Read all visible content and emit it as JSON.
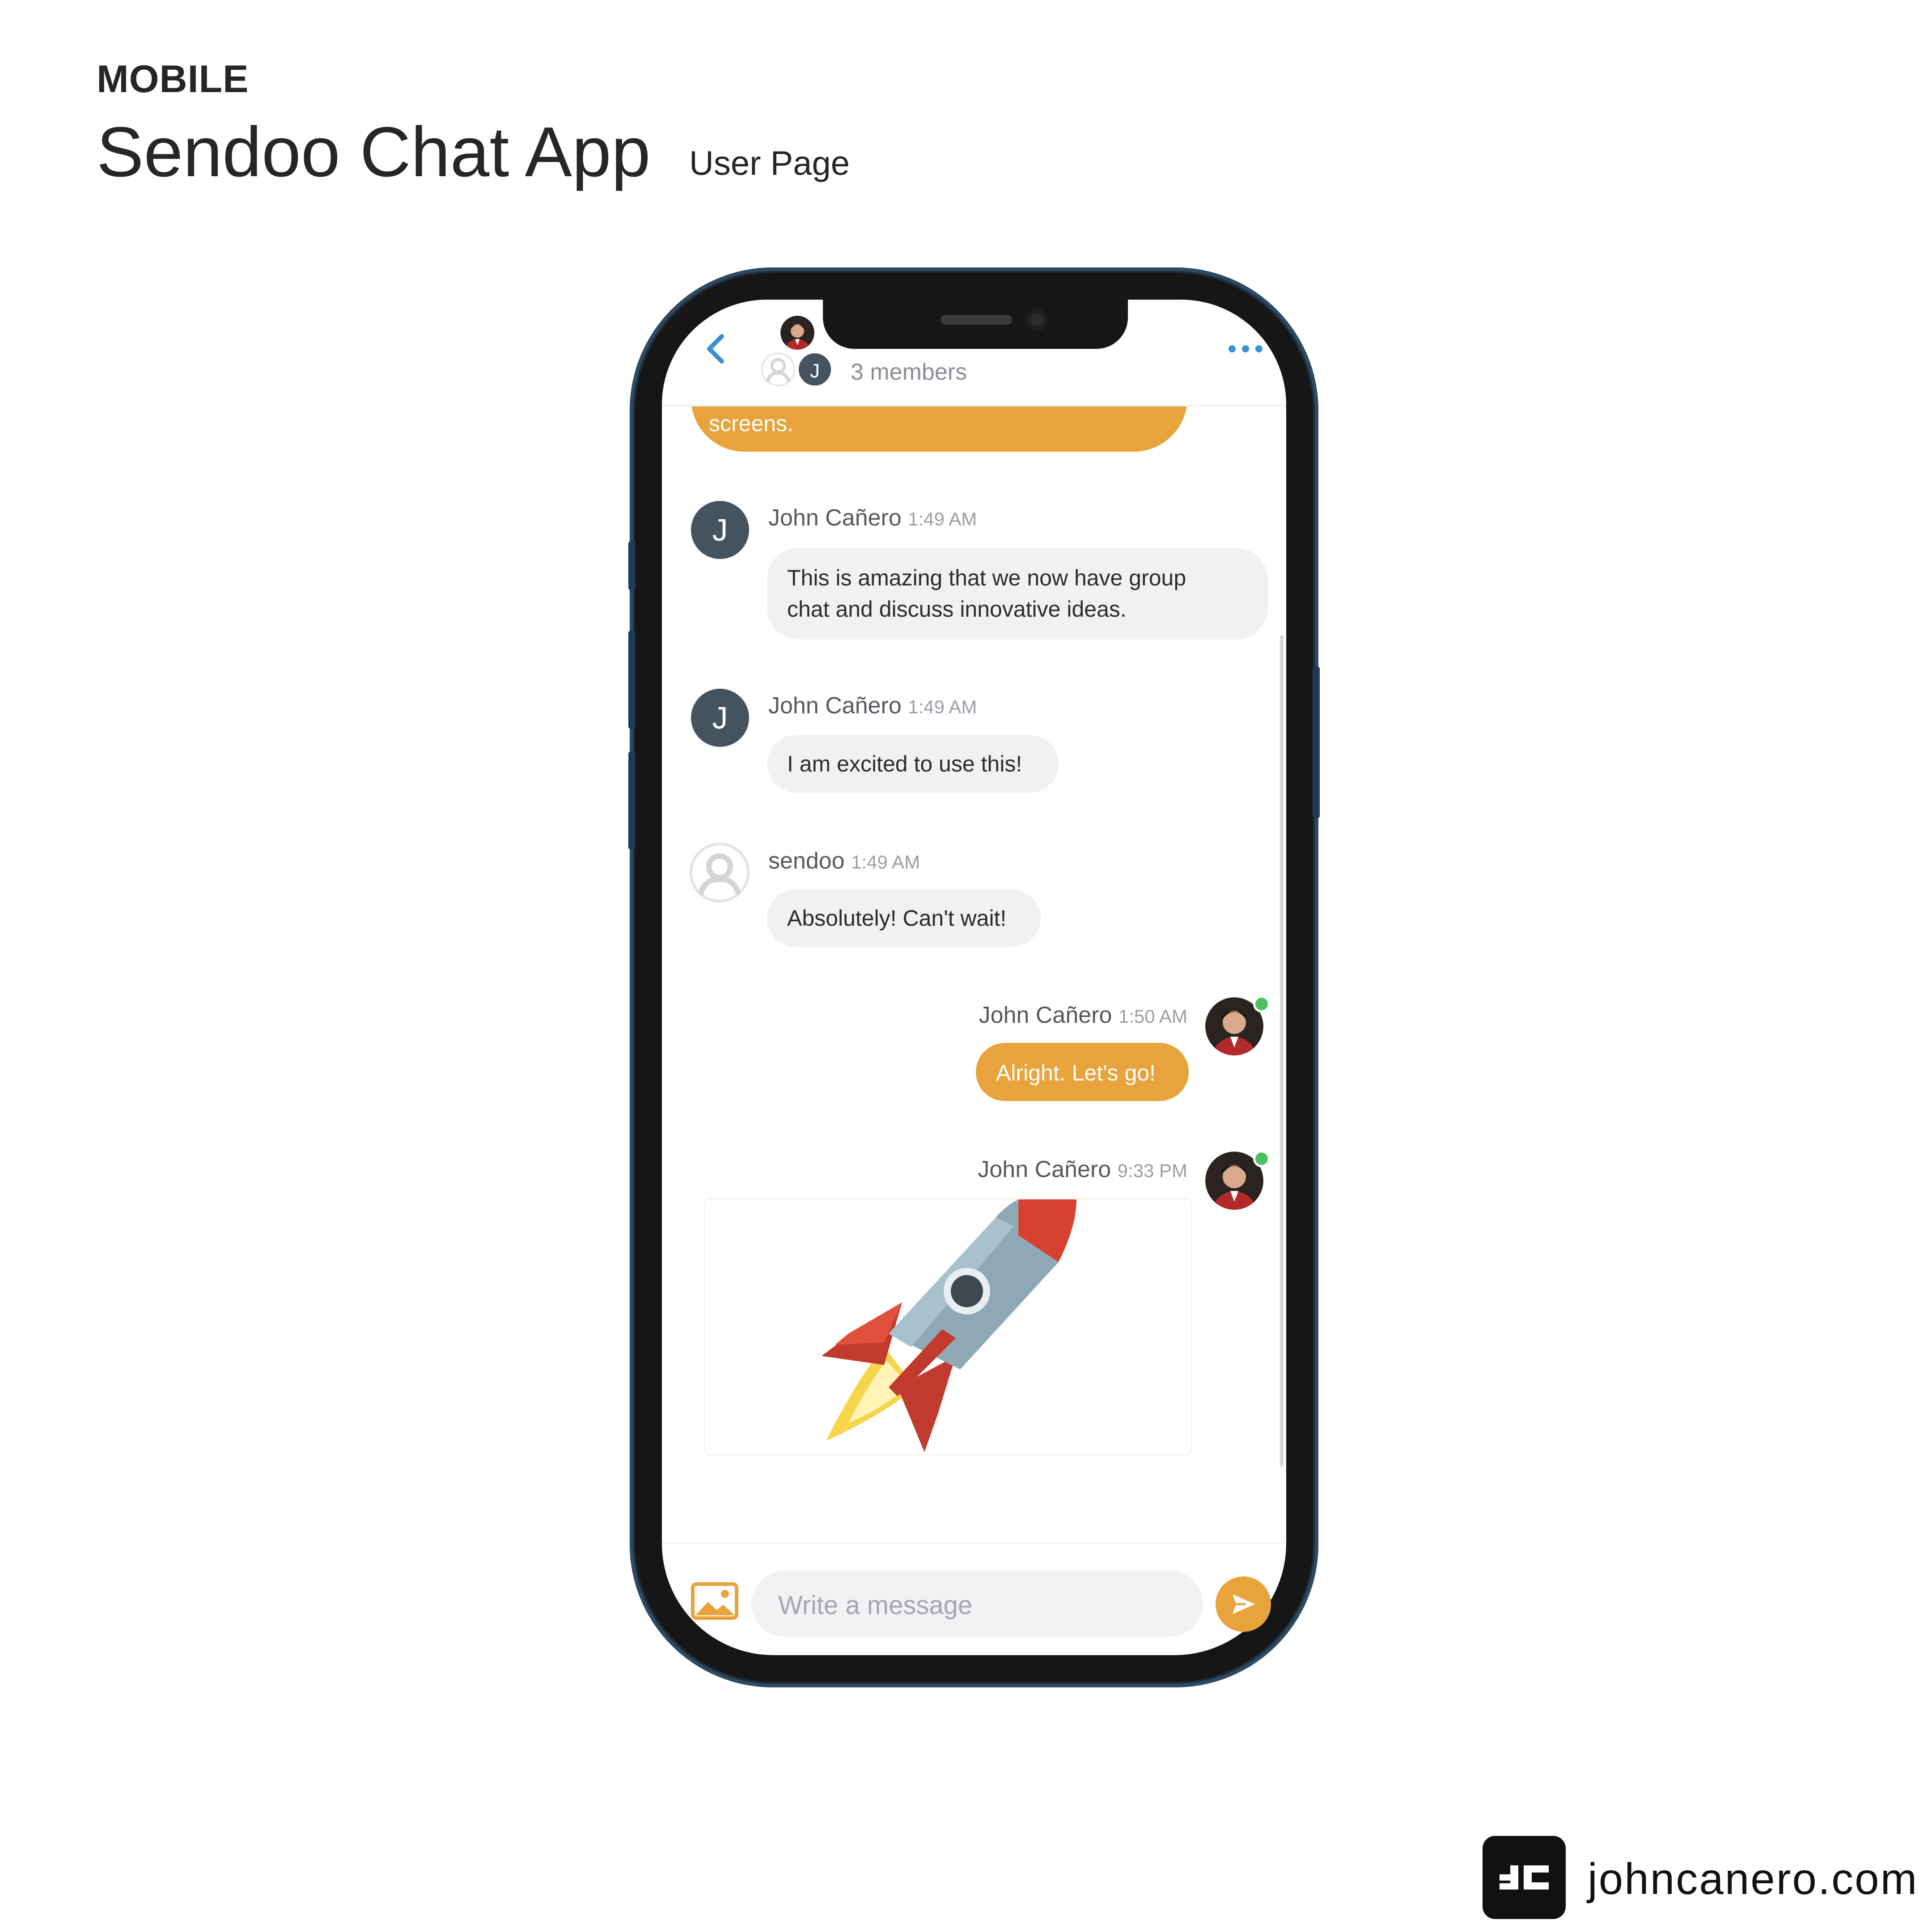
{
  "page": {
    "eyebrow": "MOBILE",
    "title": "Sendoo Chat App",
    "subtitle": "User Page",
    "brand": "johncanero.com"
  },
  "chat_header": {
    "members_label": "3 members",
    "back_icon": "chevron-left-icon",
    "menu_icon": "more-horizontal-icon"
  },
  "messages": {
    "partial_text": "screens.",
    "m1": {
      "author": "John Cañero",
      "time": "1:49 AM",
      "avatar_letter": "J",
      "line1": "This is amazing that we now have group",
      "line2": "chat and discuss innovative ideas."
    },
    "m2": {
      "author": "John Cañero",
      "time": "1:49 AM",
      "avatar_letter": "J",
      "text": "I am excited to use this!"
    },
    "m3": {
      "author": "sendoo",
      "time": "1:49 AM",
      "text": "Absolutely! Can't wait!"
    },
    "m4": {
      "author": "John Cañero",
      "time": "1:50 AM",
      "text": "Alright. Let's go!"
    },
    "m5": {
      "author": "John Cañero",
      "time": "9:33 PM",
      "image": "rocket-emoji"
    }
  },
  "composer": {
    "placeholder": "Write a message",
    "image_icon": "image-icon",
    "send_icon": "send-icon"
  },
  "header_avatar_letter": "J",
  "colors": {
    "accent": "#e9a33c",
    "link": "#3a8fd6",
    "avatar_dark": "#45535f",
    "online": "#4cc15d"
  }
}
